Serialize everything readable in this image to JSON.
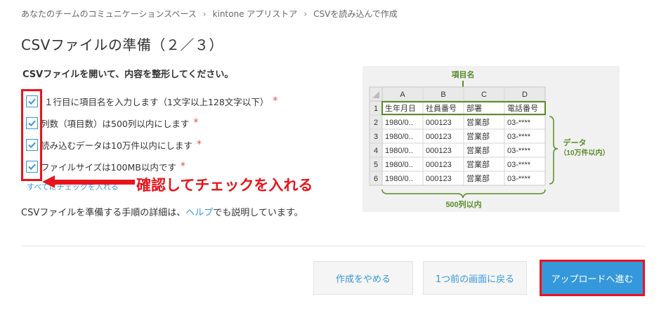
{
  "breadcrumb": [
    "あなたのチームのコミュニケーションスペース",
    "kintone アプリストア",
    "CSVを読み込んで作成"
  ],
  "page_title": "CSVファイルの準備（２／３）",
  "instruction": "CSVファイルを開いて、内容を整形してください。",
  "checklist": [
    {
      "label": "１行目に項目名を入力します（1文字以上128文字以下）",
      "checked": true,
      "required": "*"
    },
    {
      "label": "列数（項目数）は500列以内にします",
      "checked": true,
      "required": "*"
    },
    {
      "label": "読み込むデータは10万件以内にします",
      "checked": true,
      "required": "*"
    },
    {
      "label": "ファイルサイズは100MB以内です",
      "checked": true,
      "required": "*"
    }
  ],
  "check_all_link": "すべてにチェックを入れる",
  "annotation": "確認してチェックを入れる",
  "help": {
    "prefix": "CSVファイルを準備する手順の詳細は、",
    "link": "ヘルプ",
    "suffix": "でも説明しています。"
  },
  "illustration": {
    "header_label": "項目名",
    "data_label_1": "データ",
    "data_label_2": "（10万件以内）",
    "columns_label": "500列以内",
    "col_letters": [
      "A",
      "B",
      "C",
      "D"
    ],
    "row_numbers": [
      "1",
      "2",
      "3",
      "4",
      "5",
      "6"
    ],
    "header_cells": [
      "生年月日",
      "社員番号",
      "部署",
      "電話番号"
    ],
    "data_rows": [
      [
        "1980/0..",
        "000123",
        "営業部",
        "03-****"
      ],
      [
        "1980/0..",
        "000123",
        "営業部",
        "03-****"
      ],
      [
        "1980/0..",
        "000123",
        "営業部",
        "03-****"
      ],
      [
        "1980/0..",
        "000123",
        "営業部",
        "03-****"
      ],
      [
        "1980/0..",
        "000123",
        "営業部",
        "03-****"
      ]
    ],
    "colors": {
      "green": "#5a8a2a",
      "red": "#e8141c",
      "blue": "#3498db"
    }
  },
  "buttons": {
    "cancel": "作成をやめる",
    "back": "1つ前の画面に戻る",
    "next": "アップロードへ進む"
  }
}
